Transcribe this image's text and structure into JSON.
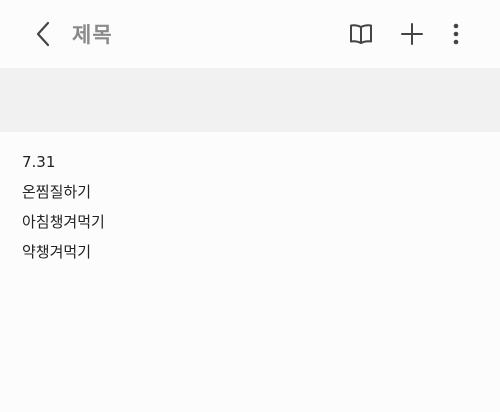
{
  "header": {
    "title": "제목",
    "icons": {
      "back": "chevron-left-icon",
      "book": "book-open-icon",
      "add": "plus-icon",
      "more": "more-vertical-icon"
    }
  },
  "note": {
    "lines": [
      "7.31",
      "온찜질하기",
      "아침챙겨먹기",
      "약챙겨먹기"
    ]
  },
  "colors": {
    "background": "#fcfcfc",
    "banner": "#f1f1f1",
    "title": "#8a8a8a",
    "icon": "#444444",
    "text": "#222222"
  }
}
